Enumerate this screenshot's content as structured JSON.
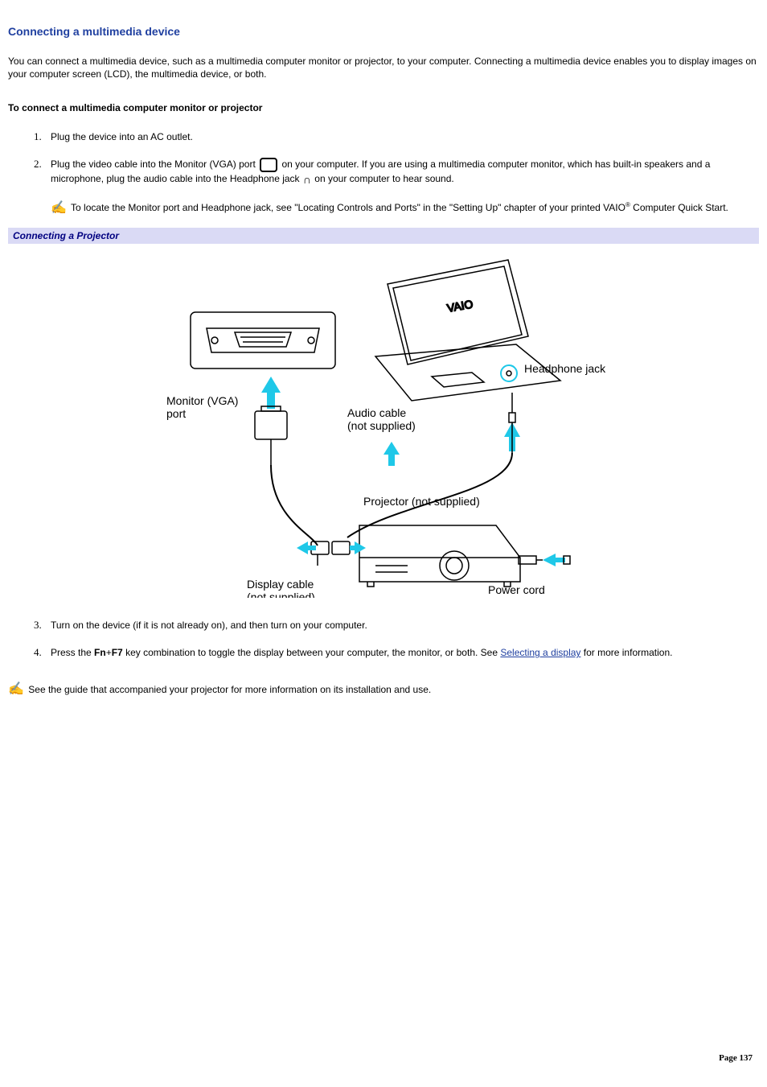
{
  "title": "Connecting a multimedia device",
  "intro": "You can connect a multimedia device, such as a multimedia computer monitor or projector, to your computer. Connecting a multimedia device enables you to display images on your computer screen (LCD), the multimedia device, or both.",
  "subtitle": "To connect a multimedia computer monitor or projector",
  "step1": "Plug the device into an AC outlet.",
  "step2_a": "Plug the video cable into the Monitor (VGA) port ",
  "step2_b": " on your computer. If you are using a multimedia computer monitor, which has built-in speakers and a microphone, plug the audio cable into the Headphone jack ",
  "step2_c": " on your computer to hear sound.",
  "step2_note_a": "To locate the Monitor port and Headphone jack, see \"Locating Controls and Ports\" in the \"Setting Up\" chapter of your printed VAIO",
  "step2_note_b": " Computer Quick Start.",
  "reg": "®",
  "section_bar": "Connecting a Projector",
  "diagram": {
    "monitor_port": "Monitor (VGA)\nport",
    "headphone_jack": "Headphone jack",
    "audio_cable": "Audio cable\n(not supplied)",
    "projector": "Projector (not supplied)",
    "display_cable": "Display cable\n(not supplied)",
    "power_cord": "Power cord"
  },
  "step3": "Turn on the device (if it is not already on), and then turn on your computer.",
  "step4_a": "Press the ",
  "step4_key1": "Fn",
  "step4_plus": "+",
  "step4_key2": "F7",
  "step4_b": " key combination to toggle the display between your computer, the monitor, or both. See ",
  "step4_link": "Selecting a display",
  "step4_c": " for more information.",
  "bottom_note": "See the guide that accompanied your projector for more information on its installation and use.",
  "page_label": "Page 137"
}
